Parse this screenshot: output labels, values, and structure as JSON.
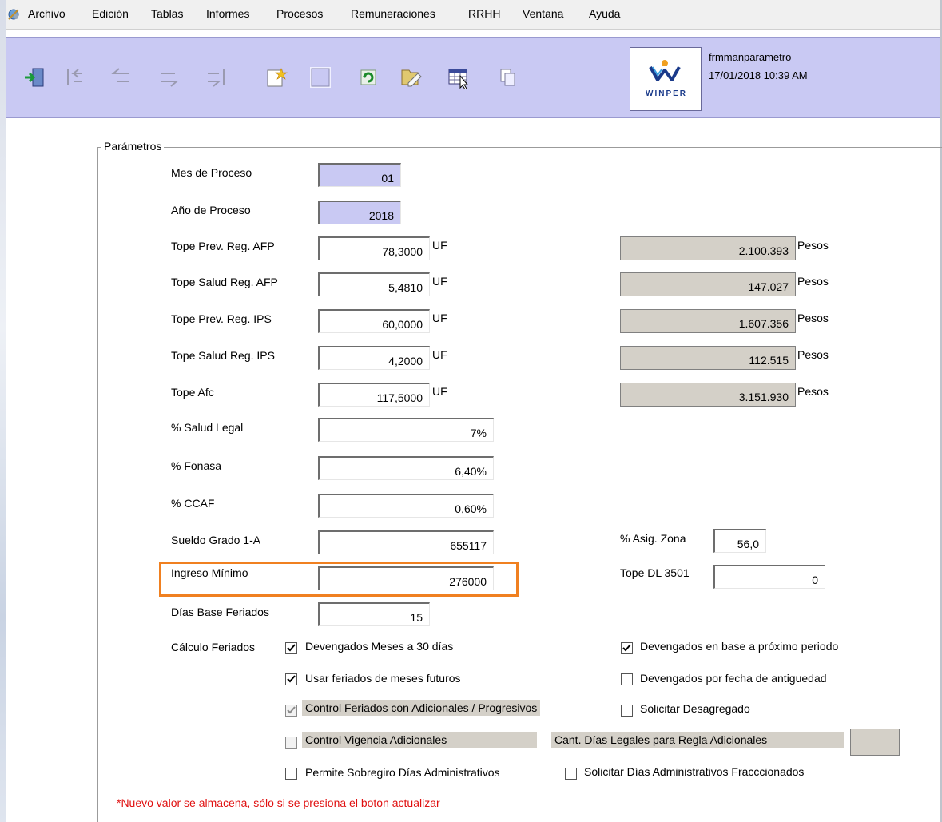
{
  "menu": [
    "Archivo",
    "Edición",
    "Tablas",
    "Informes",
    "Procesos",
    "Remuneraciones",
    "RRHH",
    "Ventana",
    "Ayuda"
  ],
  "toolbar": {
    "buttons": [
      "exit-icon",
      "first-record-icon",
      "previous-record-icon",
      "next-record-icon",
      "last-record-icon",
      "new-record-icon",
      "blank-icon",
      "refresh-icon",
      "edit-icon",
      "view-grid-icon",
      "copy-icon"
    ],
    "logo_text": "WINPER",
    "form_name": "frmmanparametro",
    "datetime": "17/01/2018 10:39 AM"
  },
  "group_title": "Parámetros",
  "fields": {
    "mes_proceso": {
      "label": "Mes de Proceso",
      "value": "01"
    },
    "anio_proceso": {
      "label": "Año de Proceso",
      "value": "2018"
    },
    "tope_prev_afp": {
      "label": "Tope Prev. Reg. AFP",
      "value": "78,3000",
      "unit": "UF",
      "pesos": "2.100.393",
      "pesos_unit": "Pesos"
    },
    "tope_salud_afp": {
      "label": "Tope Salud Reg. AFP",
      "value": "5,4810",
      "unit": "UF",
      "pesos": "147.027",
      "pesos_unit": "Pesos"
    },
    "tope_prev_ips": {
      "label": "Tope Prev. Reg. IPS",
      "value": "60,0000",
      "unit": "UF",
      "pesos": "1.607.356",
      "pesos_unit": "Pesos"
    },
    "tope_salud_ips": {
      "label": "Tope Salud Reg. IPS",
      "value": "4,2000",
      "unit": "UF",
      "pesos": "112.515",
      "pesos_unit": "Pesos"
    },
    "tope_afc": {
      "label": "Tope Afc",
      "value": "117,5000",
      "unit": "UF",
      "pesos": "3.151.930",
      "pesos_unit": "Pesos"
    },
    "salud_legal": {
      "label": "% Salud Legal",
      "value": "7%"
    },
    "fonasa": {
      "label": "% Fonasa",
      "value": "6,40%"
    },
    "ccaf": {
      "label": "% CCAF",
      "value": "0,60%"
    },
    "sueldo_grado": {
      "label": "Sueldo Grado 1-A",
      "value": "655117"
    },
    "asig_zona": {
      "label": "% Asig. Zona",
      "value": "56,0"
    },
    "ingreso_minimo": {
      "label": "Ingreso Mínimo",
      "value": "276000"
    },
    "tope_dl": {
      "label": "Tope DL 3501",
      "value": "0"
    },
    "dias_base": {
      "label": "Días Base Feriados",
      "value": "15"
    },
    "calculo_feriados_label": "Cálculo Feriados"
  },
  "checkboxes": {
    "meses_30": {
      "label": "Devengados Meses a 30 días",
      "checked": true
    },
    "proximo_periodo": {
      "label": "Devengados en base a próximo periodo",
      "checked": true
    },
    "feriados_futuros": {
      "label": "Usar feriados de meses futuros",
      "checked": true
    },
    "fecha_antiguedad": {
      "label": "Devengados por fecha de antiguedad",
      "checked": false
    },
    "control_adicionales": {
      "label": "Control Feriados con Adicionales / Progresivos",
      "checked": true
    },
    "desagregado": {
      "label": "Solicitar Desagregado",
      "checked": false
    },
    "vigencia_adicionales": {
      "label": "Control Vigencia Adicionales",
      "checked": false
    },
    "cant_dias_label": "Cant. Días Legales para Regla Adicionales",
    "sobregiro": {
      "label": "Permite Sobregiro Días Administrativos",
      "checked": false
    },
    "fraccionados": {
      "label": "Solicitar Días Administrativos Fracccionados",
      "checked": false
    }
  },
  "footnote": "*Nuevo valor se almacena, sólo si se presiona el boton actualizar",
  "colors": {
    "toolbar_bg": "#c9c9f3",
    "highlight": "#f08020",
    "footnote": "#e01010",
    "disabled_bg": "#d4d0c8"
  }
}
